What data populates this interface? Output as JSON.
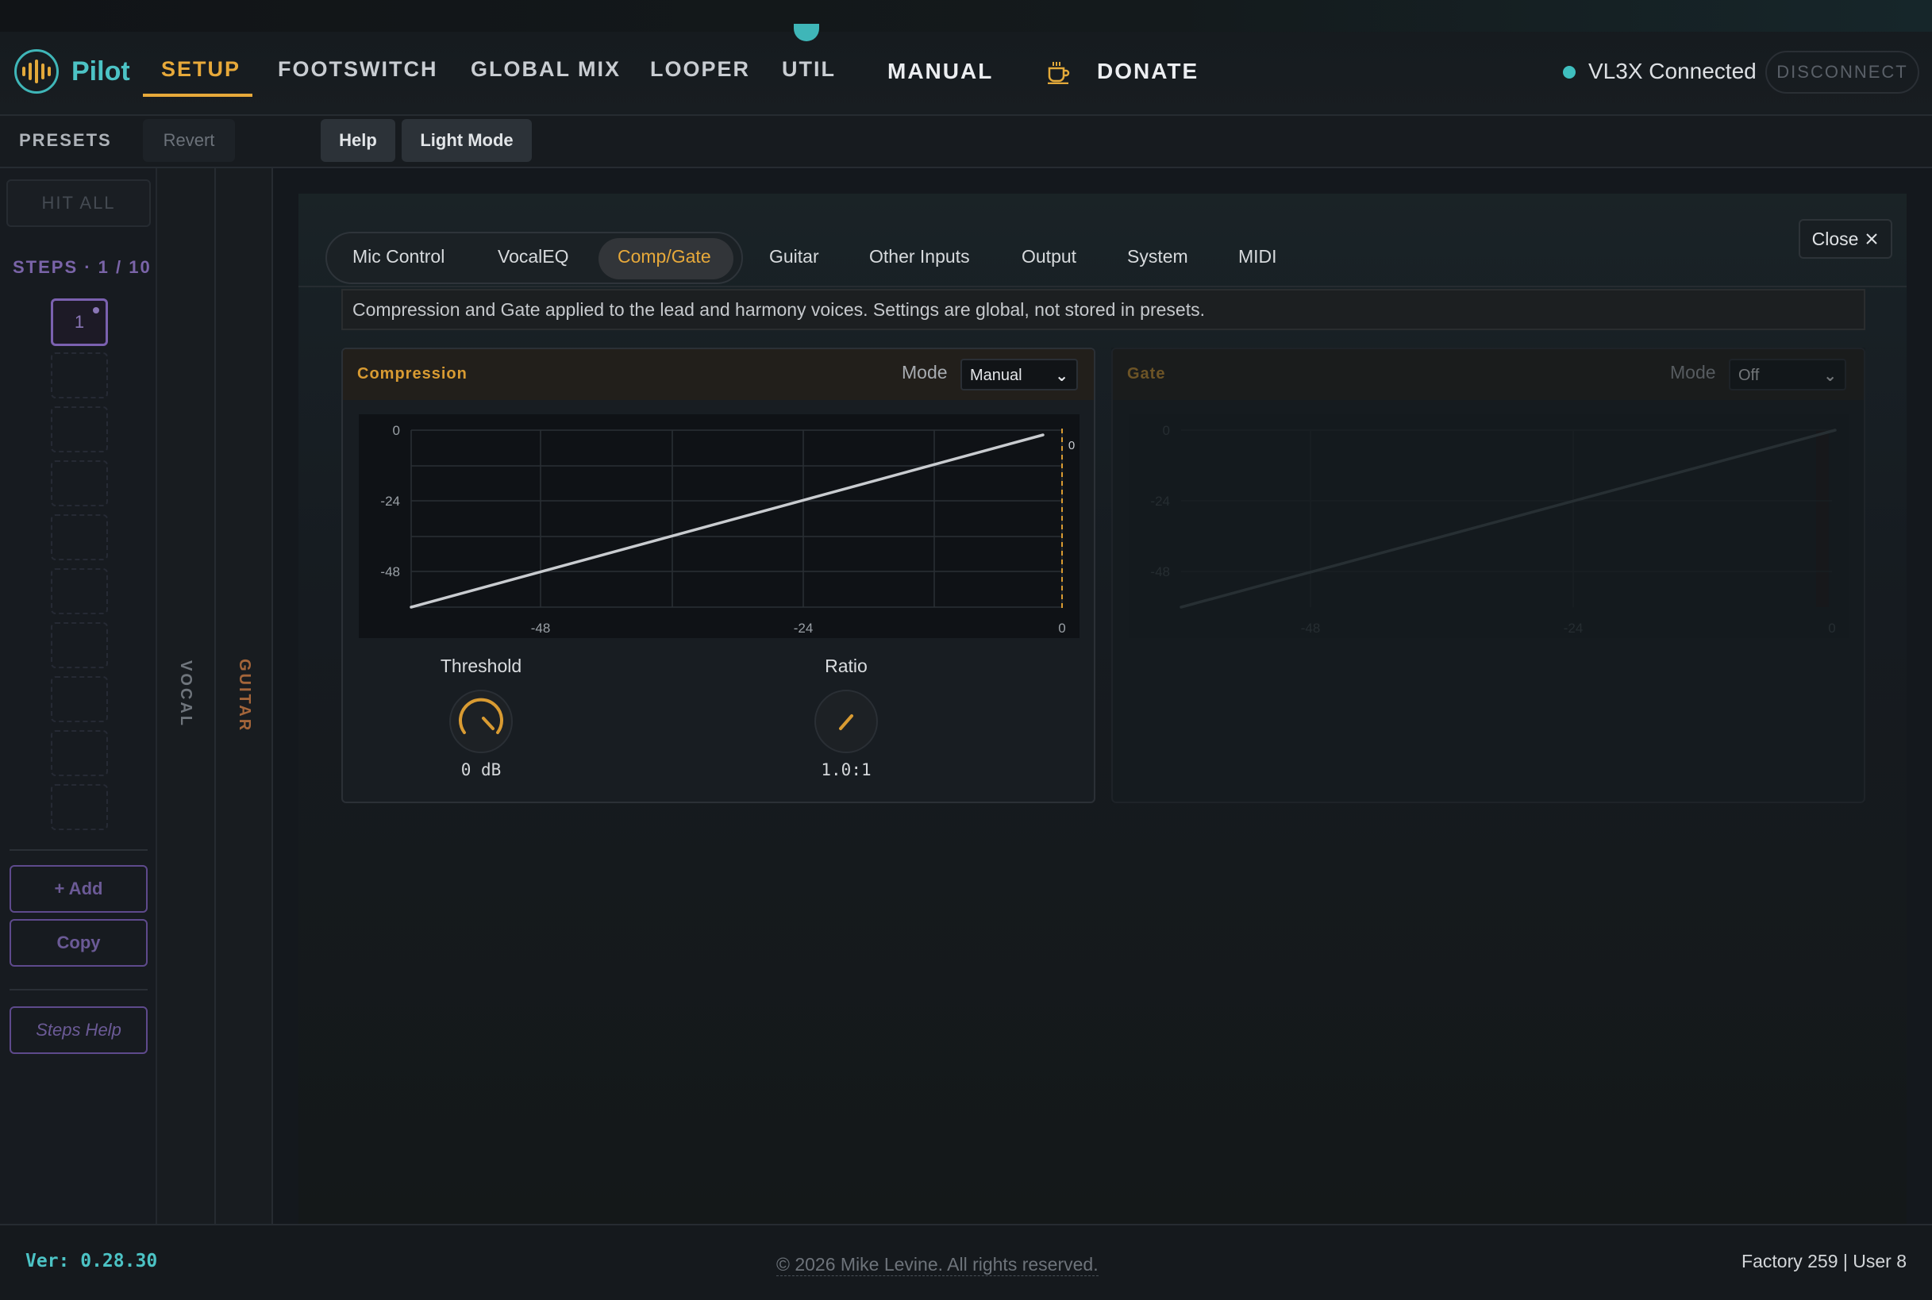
{
  "app": {
    "name": "Pilot"
  },
  "nav": {
    "items": [
      "SETUP",
      "FOOTSWITCH",
      "GLOBAL MIX",
      "LOOPER",
      "UTIL"
    ],
    "active": "SETUP",
    "manual": "MANUAL",
    "donate": "DONATE"
  },
  "connection": {
    "status": "VL3X Connected",
    "disconnect": "DISCONNECT"
  },
  "toolbar": {
    "presets": "PRESETS",
    "revert": "Revert",
    "help": "Help",
    "light_mode": "Light Mode"
  },
  "sidebar": {
    "hit_all": "HIT ALL",
    "steps": "STEPS · 1 / 10",
    "step_current": "1",
    "add": "+ Add",
    "copy": "Copy",
    "steps_help": "Steps Help"
  },
  "strips": {
    "vocal": "VOCAL",
    "guitar": "GUITAR"
  },
  "panel": {
    "tabs": [
      "Mic Control",
      "VocalEQ",
      "Comp/Gate",
      "Guitar",
      "Other Inputs",
      "Output",
      "System",
      "MIDI"
    ],
    "active_tab": "Comp/Gate",
    "close": "Close",
    "description": "Compression and Gate applied to the lead and harmony voices. Settings are global, not stored in presets."
  },
  "compression": {
    "title": "Compression",
    "mode_label": "Mode",
    "mode_value": "Manual",
    "threshold_label": "Threshold",
    "threshold_value": "0 dB",
    "ratio_label": "Ratio",
    "ratio_value": "1.0:1",
    "threshold_marker": "0"
  },
  "gate": {
    "title": "Gate",
    "mode_label": "Mode",
    "mode_value": "Off"
  },
  "graph_axis": {
    "y_ticks": [
      "0",
      "-24",
      "-48"
    ],
    "x_ticks": [
      "-48",
      "-24",
      "0"
    ]
  },
  "footer": {
    "version": "Ver: 0.28.30",
    "copyright": "© 2026 Mike Levine. All rights reserved.",
    "preset_counts": "Factory 259 | User 8"
  },
  "colors": {
    "accent": "#e7a93a",
    "teal": "#4cc3c5",
    "purple": "#7b61b0"
  }
}
